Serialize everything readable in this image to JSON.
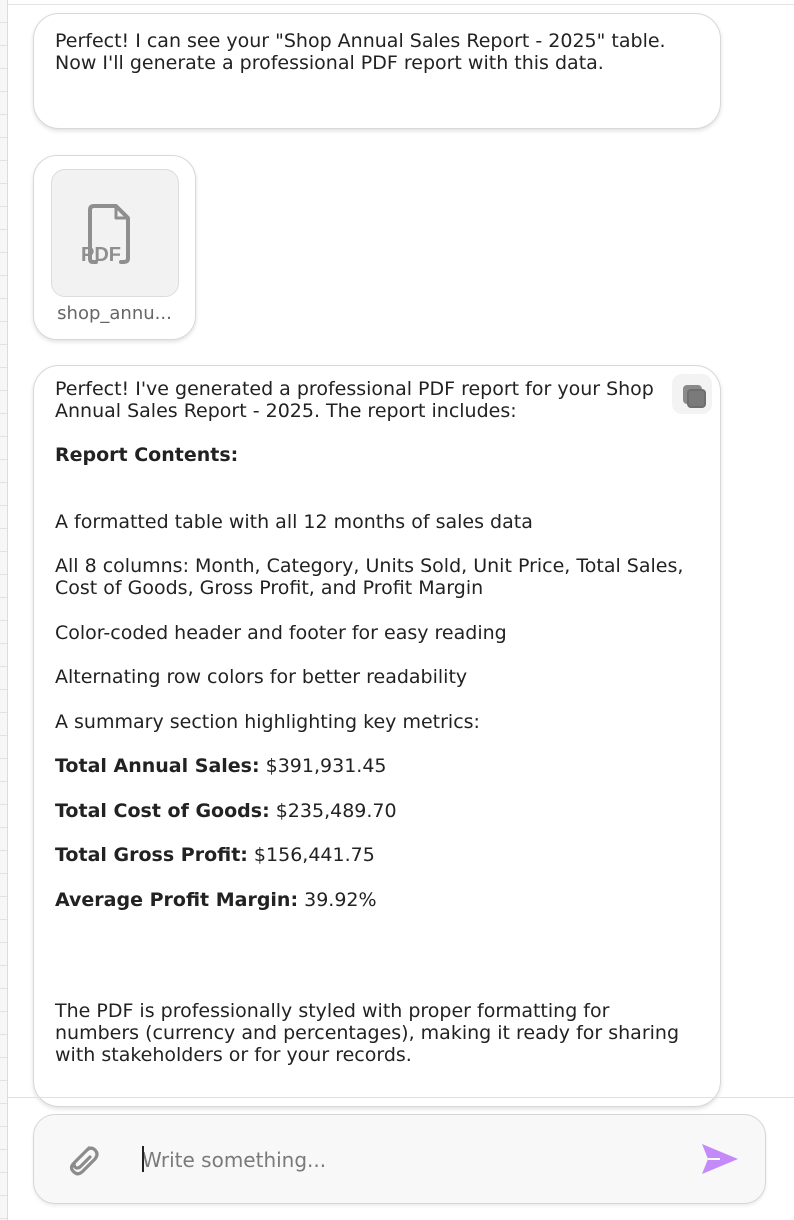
{
  "messages": {
    "first": {
      "text": "Perfect! I can see your \"Shop Annual Sales Report - 2025\" table. Now I'll generate a professional PDF report with this data."
    },
    "attachment": {
      "type_label": "PDF",
      "filename": "shop_annu..."
    },
    "second": {
      "intro": "Perfect! I've generated a professional PDF report for your Shop Annual Sales Report - 2025. The report includes:",
      "heading": "Report Contents:",
      "items": [
        "A formatted table with all 12 months of sales data",
        "All 8 columns: Month, Category, Units Sold, Unit Price, Total Sales, Cost of Goods, Gross Profit, and Profit Margin",
        "Color-coded header and footer for easy reading",
        "Alternating row colors for better readability",
        "A summary section highlighting key metrics:"
      ],
      "metrics": [
        {
          "label": "Total Annual Sales:",
          "value": " $391,931.45"
        },
        {
          "label": "Total Cost of Goods:",
          "value": " $235,489.70"
        },
        {
          "label": "Total Gross Profit:",
          "value": " $156,441.75"
        },
        {
          "label": "Average Profit Margin:",
          "value": " 39.92%"
        }
      ],
      "closing": "The PDF is professionally styled with proper formatting for numbers (currency and percentages), making it ready for sharing with stakeholders or for your records."
    }
  },
  "composer": {
    "placeholder": "Write something..."
  },
  "icons": {
    "copy": "copy-icon",
    "attach": "paperclip-icon",
    "send": "send-icon",
    "file": "pdf-file-icon"
  },
  "colors": {
    "send_accent": "#c58af9"
  }
}
